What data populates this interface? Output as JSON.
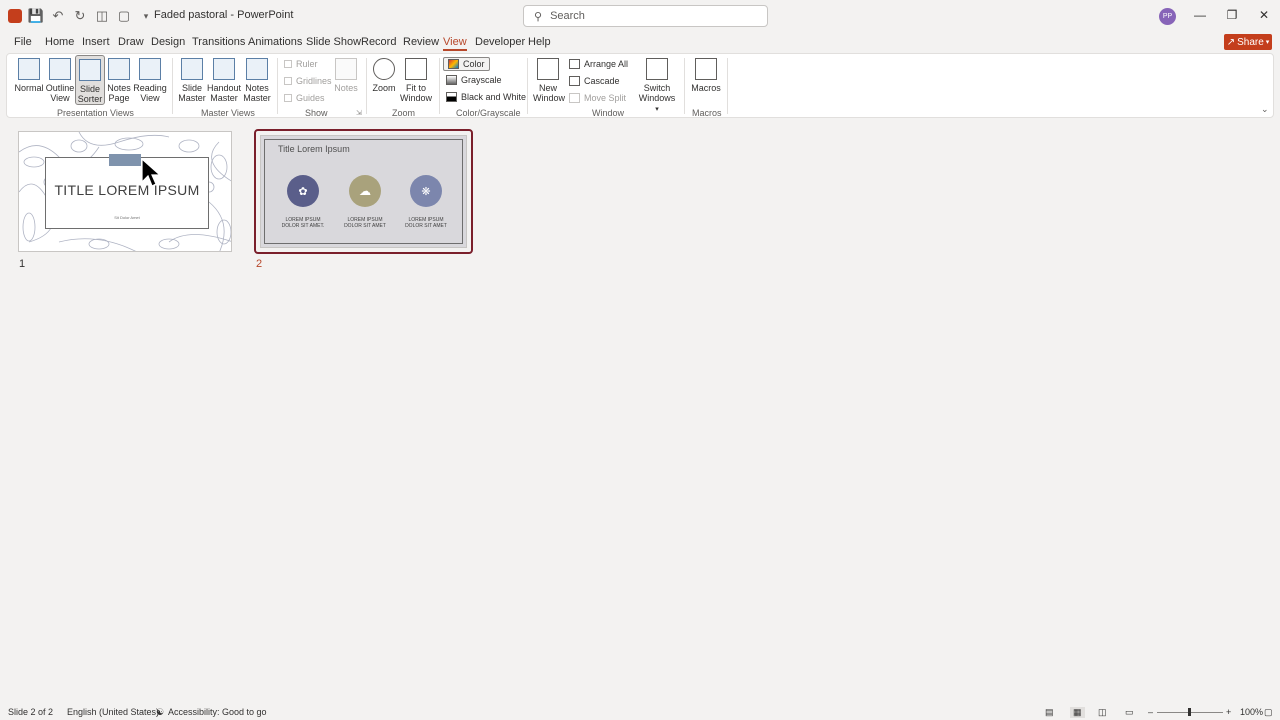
{
  "window": {
    "title": "Faded pastoral  -  PowerPoint",
    "search_placeholder": "Search",
    "avatar_initials": "PP",
    "share_label": "Share"
  },
  "tabs": [
    "File",
    "Home",
    "Insert",
    "Draw",
    "Design",
    "Transitions",
    "Animations",
    "Slide Show",
    "Record",
    "Review",
    "View",
    "Developer",
    "Help"
  ],
  "active_tab": "View",
  "ribbon": {
    "presentation_views": {
      "label": "Presentation Views",
      "buttons": [
        {
          "l1": "Normal",
          "l2": ""
        },
        {
          "l1": "Outline",
          "l2": "View"
        },
        {
          "l1": "Slide",
          "l2": "Sorter"
        },
        {
          "l1": "Notes",
          "l2": "Page"
        },
        {
          "l1": "Reading",
          "l2": "View"
        }
      ]
    },
    "master_views": {
      "label": "Master Views",
      "buttons": [
        {
          "l1": "Slide",
          "l2": "Master"
        },
        {
          "l1": "Handout",
          "l2": "Master"
        },
        {
          "l1": "Notes",
          "l2": "Master"
        }
      ]
    },
    "show": {
      "label": "Show",
      "checks": [
        "Ruler",
        "Gridlines",
        "Guides"
      ],
      "notes": "Notes"
    },
    "zoom": {
      "label": "Zoom",
      "zoom": "Zoom",
      "fit_l1": "Fit to",
      "fit_l2": "Window"
    },
    "color": {
      "label": "Color/Grayscale",
      "items": [
        "Color",
        "Grayscale",
        "Black and White"
      ]
    },
    "window": {
      "label": "Window",
      "new_l1": "New",
      "new_l2": "Window",
      "items": [
        "Arrange All",
        "Cascade",
        "Move Split"
      ],
      "switch_l1": "Switch",
      "switch_l2": "Windows"
    },
    "macros": {
      "label": "Macros",
      "button": "Macros"
    }
  },
  "slides": [
    {
      "number": "1",
      "title": "TITLE LOREM IPSUM",
      "subtitle": "Sit Dolor Amet"
    },
    {
      "number": "2",
      "title": "Title Lorem Ipsum",
      "items": [
        {
          "l1": "LOREM IPSUM",
          "l2": "DOLOR SIT AMET.",
          "color": "#5a5e8a"
        },
        {
          "l1": "LOREM IPSUM",
          "l2": "DOLOR SIT AMET",
          "color": "#a9a27c"
        },
        {
          "l1": "LOREM IPSUM",
          "l2": "DOLOR SIT AMET",
          "color": "#7c86ad"
        }
      ]
    }
  ],
  "status": {
    "slide": "Slide 2 of 2",
    "language": "English (United States)",
    "accessibility": "Accessibility: Good to go",
    "zoom": "100%"
  },
  "colors": {
    "accent": "#b7472a",
    "selected_slide_border": "#7a1f2b",
    "share_bg": "#c43e1c"
  }
}
